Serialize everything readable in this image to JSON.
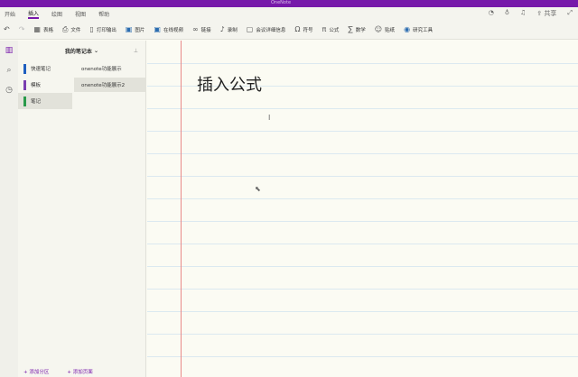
{
  "window": {
    "title": "OneNote"
  },
  "ribbon_tabs": [
    "开始",
    "插入",
    "绘图",
    "视图",
    "帮助"
  ],
  "share_label": "共享",
  "toolbar": [
    {
      "icon": "table-icon",
      "label": "表格"
    },
    {
      "icon": "file-icon",
      "label": "文件"
    },
    {
      "icon": "printout-icon",
      "label": "打印输出"
    },
    {
      "icon": "picture-icon",
      "label": "图片"
    },
    {
      "icon": "online-video-icon",
      "label": "在线视频"
    },
    {
      "icon": "link-icon",
      "label": "链接"
    },
    {
      "icon": "audio-icon",
      "label": "录制"
    },
    {
      "icon": "meeting-icon",
      "label": "会议详细信息"
    },
    {
      "icon": "symbol-icon",
      "label": "符号"
    },
    {
      "icon": "equation-icon",
      "label": "公式"
    },
    {
      "icon": "math-icon",
      "label": "数学"
    },
    {
      "icon": "sticker-icon",
      "label": "贴纸"
    },
    {
      "icon": "research-icon",
      "label": "研究工具"
    }
  ],
  "notebook": {
    "name": "我的笔记本"
  },
  "sections": [
    {
      "label": "快速笔记",
      "color": "#1f5fbf"
    },
    {
      "label": "模板",
      "color": "#7a3fb0"
    },
    {
      "label": "笔记",
      "color": "#2a9a4a"
    }
  ],
  "pages": [
    "onenote功能展示",
    "onenote功能展示2"
  ],
  "add_section": "+ 添加分区",
  "add_page": "+ 添加页面",
  "page_title": "插入公式"
}
